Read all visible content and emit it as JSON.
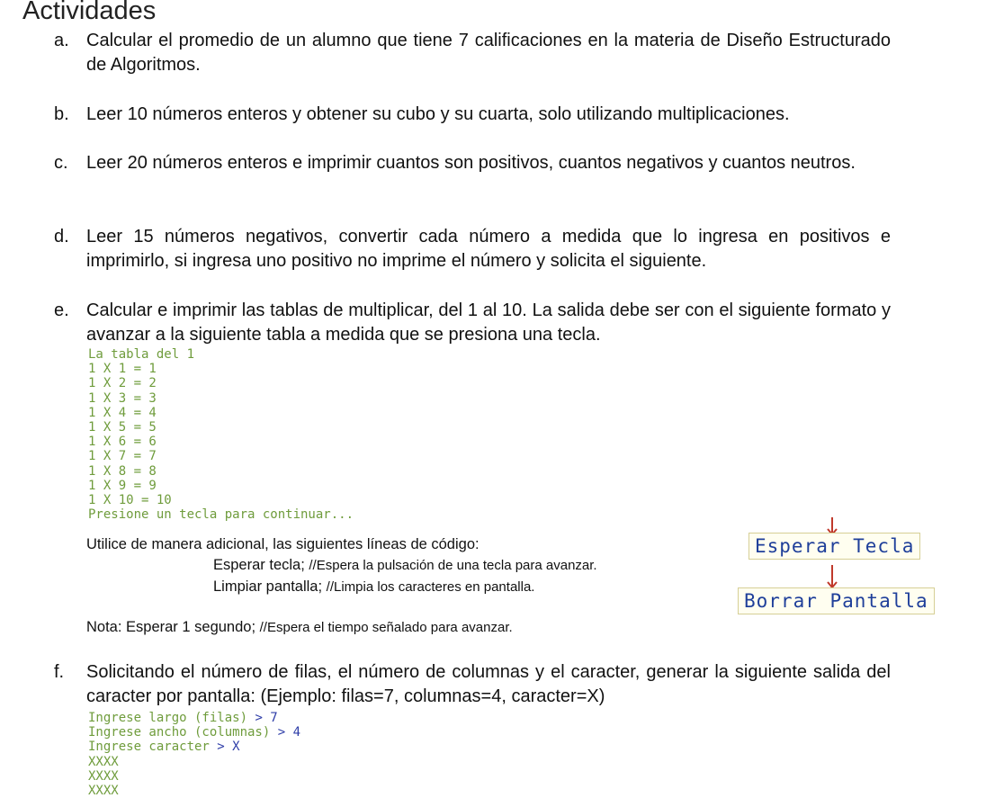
{
  "heading": "Actividades",
  "items": [
    {
      "letter": "a.",
      "text": "Calcular el promedio de un alumno que tiene 7 calificaciones en la materia de Diseño Estructurado de Algoritmos."
    },
    {
      "letter": "b.",
      "text": "Leer 10 números enteros y obtener su cubo y su cuarta, solo utilizando multiplicaciones."
    },
    {
      "letter": "c.",
      "text": "Leer 20 números enteros e imprimir cuantos son positivos, cuantos negativos y cuantos neutros."
    },
    {
      "letter": "d.",
      "text": "Leer 15 números negativos, convertir cada número a medida que lo ingresa en positivos e imprimirlo, si ingresa uno positivo no imprime el número y solicita el siguiente."
    },
    {
      "letter": "e.",
      "text": "Calcular e imprimir las tablas de multiplicar, del 1 al 10. La salida debe ser con el siguiente formato y avanzar a la siguiente tabla a medida que se presiona una tecla."
    },
    {
      "letter": "f.",
      "text": "Solicitando el número de filas, el número de columnas y el caracter, generar la siguiente salida del caracter por pantalla: (Ejemplo: filas=7, columnas=4, caracter=X)"
    }
  ],
  "console_e": {
    "header": "La tabla del 1",
    "lines": [
      "1 X 1 = 1",
      "1 X 2 = 2",
      "1 X 3 = 3",
      "1 X 4 = 4",
      "1 X 5 = 5",
      "1 X 6 = 6",
      "1 X 7 = 7",
      "1 X 8 = 8",
      "1 X 9 = 9",
      "1 X 10 = 10"
    ],
    "prompt": "Presione un tecla para continuar..."
  },
  "notes": {
    "intro": "Utilice de manera adicional, las siguientes líneas de código:",
    "line1_code": "Esperar tecla;",
    "line1_comment": "//Espera la pulsación de una tecla para avanzar.",
    "line2_code": "Limpiar pantalla;",
    "line2_comment": "//Limpia los caracteres en pantalla.",
    "nota_code": "Nota: Esperar 1 segundo;",
    "nota_comment": "//Espera el tiempo señalado para avanzar."
  },
  "flow": {
    "box1": "Esperar Tecla",
    "box2": "Borrar Pantalla",
    "arrow_color": "#c0392b"
  },
  "console_f": {
    "lines": [
      {
        "label": "Ingrese largo (filas)",
        "value": "> 7"
      },
      {
        "label": "Ingrese ancho (columnas)",
        "value": "> 4"
      },
      {
        "label": "Ingrese caracter",
        "value": "> X"
      }
    ],
    "grid": [
      "XXXX",
      "XXXX",
      "XXXX"
    ]
  }
}
